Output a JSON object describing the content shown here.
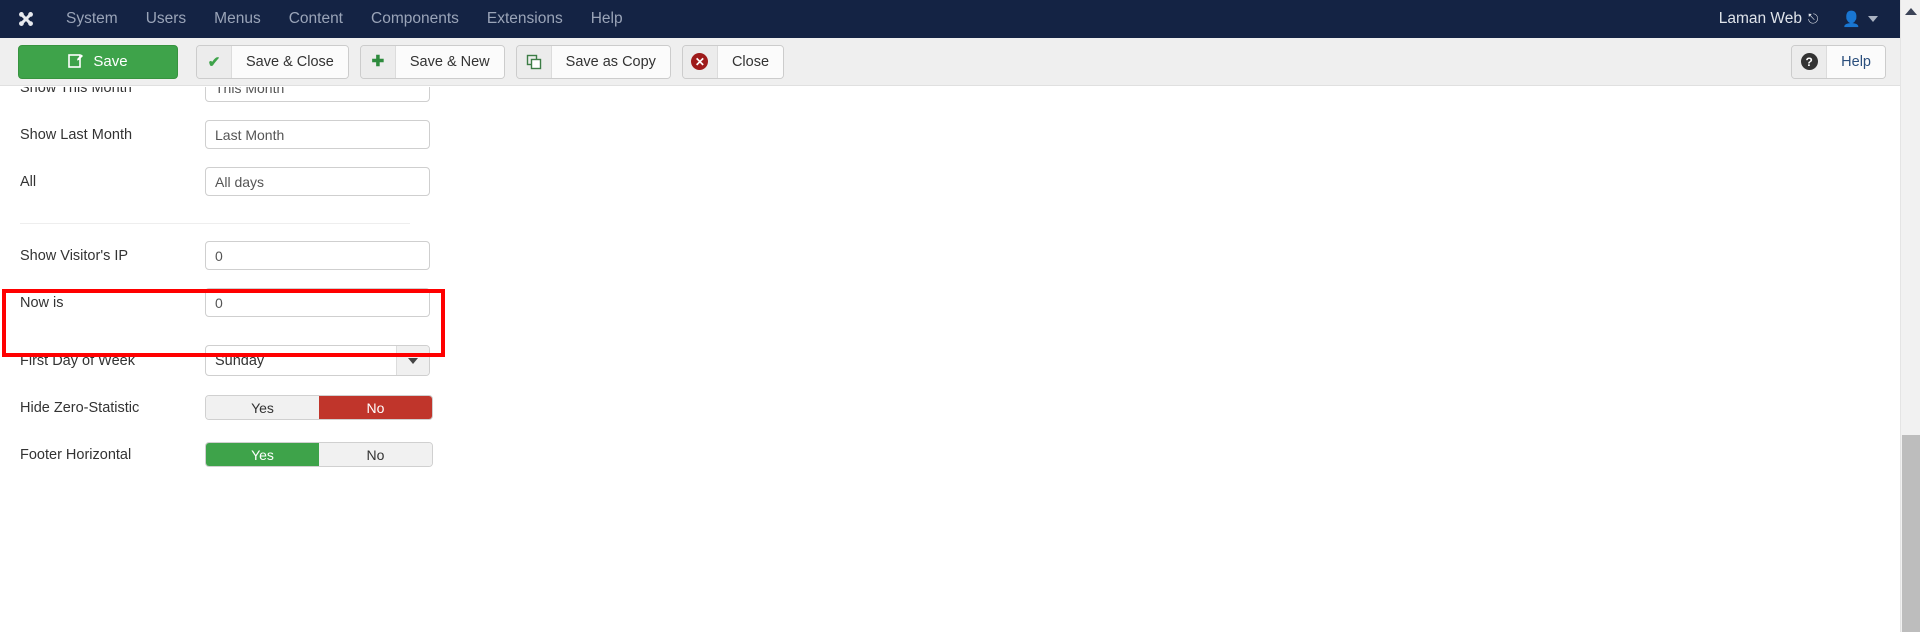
{
  "admin_bar": {
    "logo_icon": "joomla-logo-icon",
    "menu": [
      {
        "label": "System"
      },
      {
        "label": "Users"
      },
      {
        "label": "Menus"
      },
      {
        "label": "Content"
      },
      {
        "label": "Components"
      },
      {
        "label": "Extensions"
      },
      {
        "label": "Help"
      }
    ],
    "site_name": "Laman Web",
    "site_name_icon": "external-link-icon",
    "user_icon": "user-icon",
    "user_caret_icon": "chevron-down-icon"
  },
  "toolbar": {
    "save_label": "Save",
    "save_icon": "edit-pencil-icon",
    "save_close_label": "Save & Close",
    "save_close_icon": "check-icon",
    "save_new_label": "Save & New",
    "save_new_icon": "plus-icon",
    "save_copy_label": "Save as Copy",
    "save_copy_icon": "copy-icon",
    "close_label": "Close",
    "close_icon": "close-circle-icon",
    "help_label": "Help",
    "help_icon": "question-circle-icon"
  },
  "form": {
    "fields": [
      {
        "label": "Show This Month",
        "value": "This Month",
        "type": "text"
      },
      {
        "label": "Show Last Month",
        "value": "Last Month",
        "type": "text"
      },
      {
        "label": "All",
        "value": "All days",
        "type": "text"
      },
      {
        "label": "Show Visitor's IP",
        "value": "0",
        "type": "text"
      },
      {
        "label": "Now is",
        "value": "0",
        "type": "text"
      },
      {
        "label": "First Day of Week",
        "value": "Sunday",
        "type": "select"
      },
      {
        "label": "Hide Zero-Statistic",
        "value": "No",
        "type": "toggle"
      },
      {
        "label": "Footer Horizontal",
        "value": "Yes",
        "type": "toggle"
      }
    ],
    "toggle_yes_label": "Yes",
    "toggle_no_label": "No",
    "select_arrow_icon": "chevron-down-icon"
  },
  "annotation": {
    "highlight_color": "#ff0000"
  },
  "scrollbar": {
    "up_arrow_icon": "scroll-up-arrow-icon"
  }
}
